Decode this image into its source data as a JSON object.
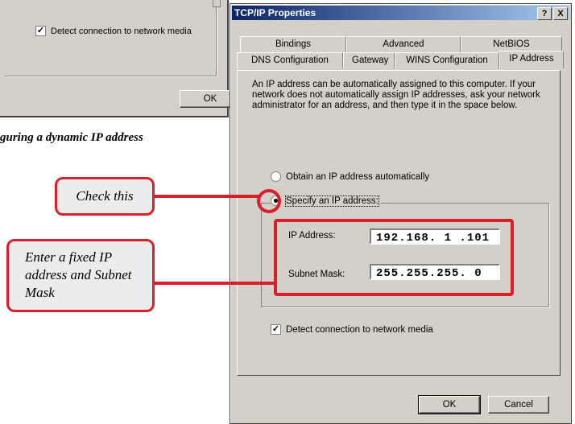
{
  "background_dialog": {
    "checkbox_label": "Detect connection to network media",
    "ok_label": "OK",
    "caption": "guring a dynamic IP address"
  },
  "dialog": {
    "title": "TCP/IP Properties",
    "help_btn": "?",
    "close_btn": "X",
    "tabs_back": [
      "Bindings",
      "Advanced",
      "NetBIOS"
    ],
    "tabs_front": [
      "DNS Configuration",
      "Gateway",
      "WINS Configuration",
      "IP Address"
    ],
    "active_tab": "IP Address",
    "description": "An IP address can be automatically assigned to this computer. If your network does not automatically assign IP addresses, ask your network administrator for an address, and then type it in the space below.",
    "radio_auto": "Obtain an IP address automatically",
    "radio_specify": "Specify an IP address:",
    "selected_radio": "specify",
    "ip_label": "IP Address:",
    "ip_value": "192.168. 1 .101",
    "subnet_label": "Subnet Mask:",
    "subnet_value": "255.255.255. 0",
    "detect_label": "Detect connection to network media",
    "detect_checked": true,
    "ok_label": "OK",
    "cancel_label": "Cancel"
  },
  "annotations": {
    "check_this": "Check this",
    "enter_fixed": "Enter a fixed IP address and Subnet Mask",
    "accent_color": "#d8202c"
  }
}
